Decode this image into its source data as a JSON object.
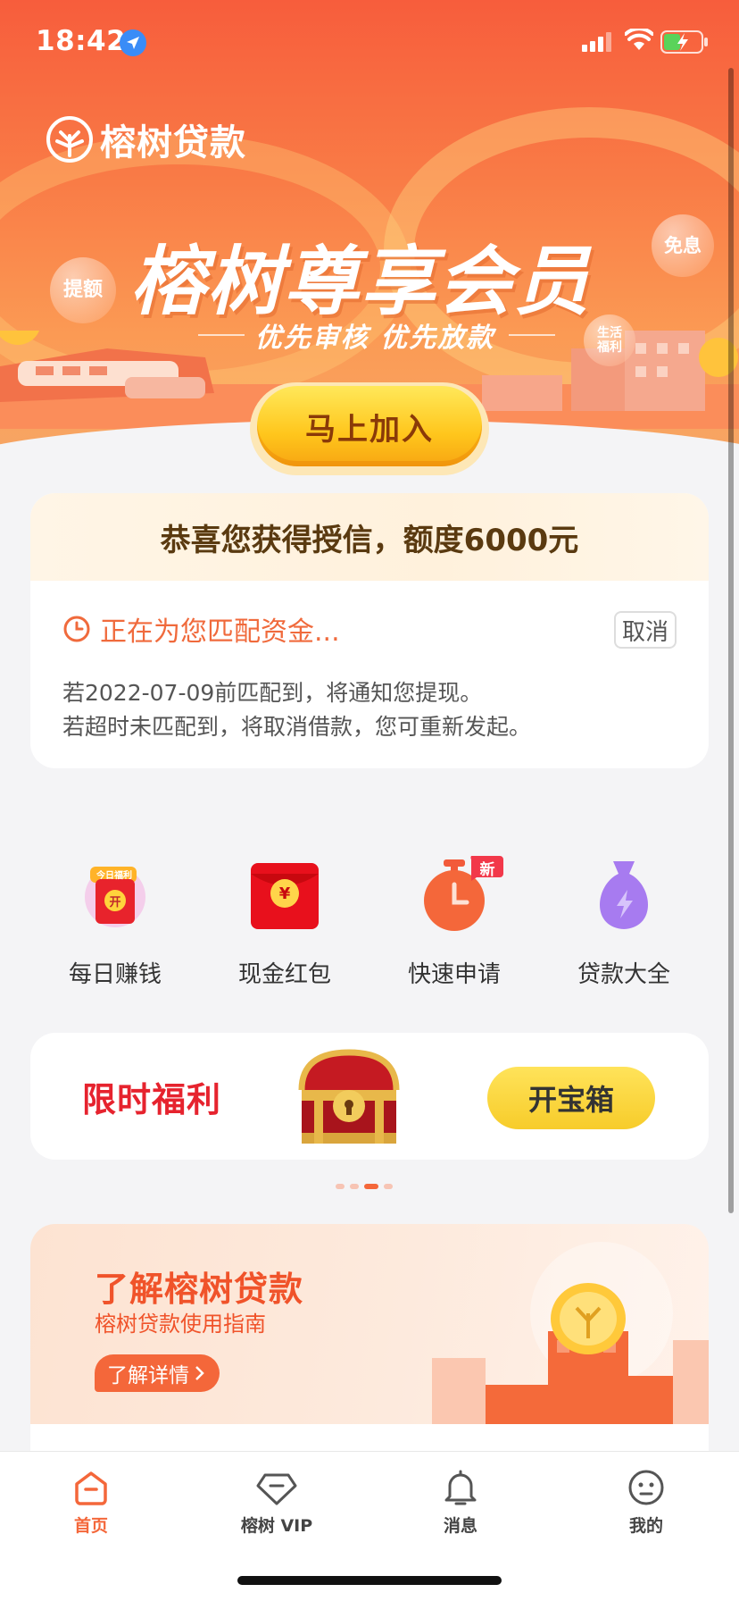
{
  "status_bar": {
    "time": "18:42"
  },
  "hero": {
    "brand": "榕树贷款",
    "title": "榕树尊享会员",
    "subtitle": "优先审核 优先放款",
    "bubble_left": "提额",
    "bubble_right": "免息",
    "bubble_small": "生活\n福利",
    "join_button": "马上加入"
  },
  "credit": {
    "headline": "恭喜您获得授信，额度6000元",
    "status": "正在为您匹配资金...",
    "cancel": "取消",
    "notice_line1": "若2022-07-09前匹配到，将通知您提现。",
    "notice_line2": "若超时未匹配到，将取消借款，您可重新发起。"
  },
  "quick_menu": [
    {
      "label": "每日赚钱",
      "icon": "daily-welfare-icon"
    },
    {
      "label": "现金红包",
      "icon": "red-packet-icon"
    },
    {
      "label": "快速申请",
      "icon": "stopwatch-icon",
      "badge": "新"
    },
    {
      "label": "贷款大全",
      "icon": "money-bag-icon"
    }
  ],
  "icon_texts": {
    "daily_tag": "今日福利",
    "daily_open": "开",
    "yuan": "¥"
  },
  "welfare": {
    "title": "限时福利",
    "button": "开宝箱",
    "carousel_active_index": 2,
    "carousel_count": 4
  },
  "guide": {
    "title": "了解榕树贷款",
    "subtitle": "榕树贷款使用指南",
    "button": "了解详情"
  },
  "tabs": [
    {
      "label": "首页",
      "icon": "home-icon",
      "active": true
    },
    {
      "label": "榕树 VIP",
      "icon": "diamond-icon",
      "active": false
    },
    {
      "label": "消息",
      "icon": "bell-icon",
      "active": false
    },
    {
      "label": "我的",
      "icon": "smiley-icon",
      "active": false
    }
  ],
  "colors": {
    "accent": "#f4673a",
    "welfare_red": "#e6232e",
    "button_yellow": "#ffd23a"
  }
}
